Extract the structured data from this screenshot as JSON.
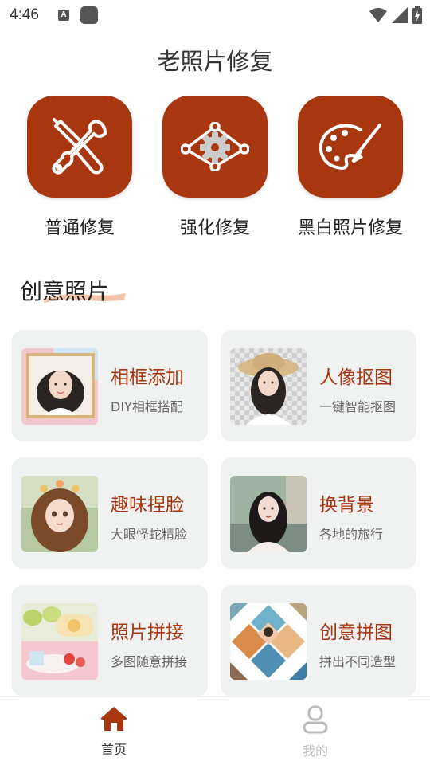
{
  "status_bar": {
    "time": "4:46",
    "a_badge": "A"
  },
  "header": {
    "title": "老照片修复"
  },
  "repair_options": [
    {
      "label": "普通修复",
      "icon": "tools-icon"
    },
    {
      "label": "强化修复",
      "icon": "enhance-gear-icon"
    },
    {
      "label": "黑白照片修复",
      "icon": "palette-icon"
    }
  ],
  "section": {
    "title": "创意照片"
  },
  "cards": [
    {
      "title": "相框添加",
      "subtitle": "DIY相框搭配",
      "thumb": "framed-portrait"
    },
    {
      "title": "人像抠图",
      "subtitle": "一键智能抠图",
      "thumb": "girl-straw-hat"
    },
    {
      "title": "趣味捏脸",
      "subtitle": "大眼怪蛇精脸",
      "thumb": "anime-girl"
    },
    {
      "title": "换背景",
      "subtitle": "各地的旅行",
      "thumb": "girl-street"
    },
    {
      "title": "照片拼接",
      "subtitle": "多图随意拼接",
      "thumb": "dessert-collage"
    },
    {
      "title": "创意拼图",
      "subtitle": "拼出不同造型",
      "thumb": "diamond-collage"
    }
  ],
  "bottom_nav": [
    {
      "label": "首页",
      "icon": "home-icon",
      "active": true
    },
    {
      "label": "我的",
      "icon": "profile-icon",
      "active": false
    }
  ],
  "colors": {
    "accent": "#a8360f",
    "card_bg": "#f0f1f1",
    "inactive_nav": "#bbbbbb"
  }
}
